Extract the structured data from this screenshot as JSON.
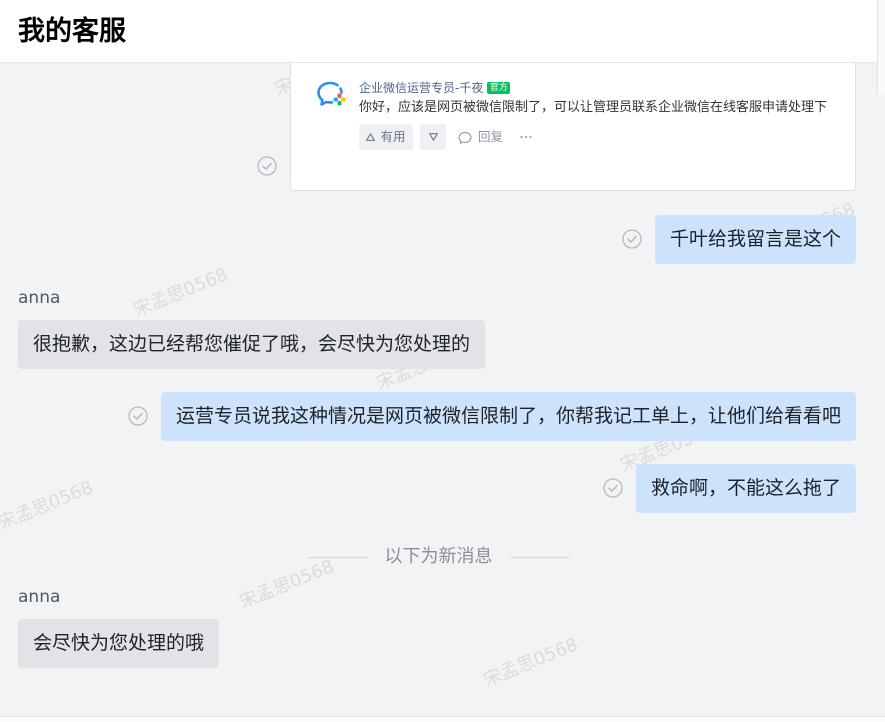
{
  "header": {
    "title": "我的客服"
  },
  "watermark": {
    "text": "宋孟思0568"
  },
  "chat": {
    "shared_post": {
      "author": "企业微信运营专员-千夜",
      "author_badge": "官方",
      "body": "你好，应该是网页被微信限制了，可以让管理员联系企业微信在线客服申请处理下",
      "upvote_label": "有用",
      "reply_label": "回复",
      "icons": {
        "avatar": "wecom-logo-icon",
        "upvote": "triangle-up-icon",
        "downvote": "triangle-down-icon",
        "reply": "comment-icon",
        "more": "more-dots-icon"
      },
      "from_me": true,
      "status_icon": "check-circle-icon"
    },
    "messages": [
      {
        "from_me": true,
        "text": "千叶给我留言是这个",
        "status_icon": "check-circle-icon"
      },
      {
        "from_me": false,
        "sender": "anna",
        "text": "很抱歉，这边已经帮您催促了哦，会尽快为您处理的"
      },
      {
        "from_me": true,
        "text": "运营专员说我这种情况是网页被微信限制了，你帮我记工单上，让他们给看看吧",
        "status_icon": "check-circle-icon"
      },
      {
        "from_me": true,
        "text": "救命啊，不能这么拖了",
        "status_icon": "check-circle-icon"
      }
    ],
    "new_messages_divider": "以下为新消息",
    "new_messages": [
      {
        "from_me": false,
        "sender": "anna",
        "text": "会尽快为您处理的哦"
      }
    ]
  },
  "colors": {
    "chat_background": "#f2f3f5",
    "outgoing_bubble": "#cde3fc",
    "incoming_bubble": "#e2e3e6",
    "official_badge": "#07c160",
    "author_name": "#51648c",
    "status_icon": "#b5b9c0"
  }
}
